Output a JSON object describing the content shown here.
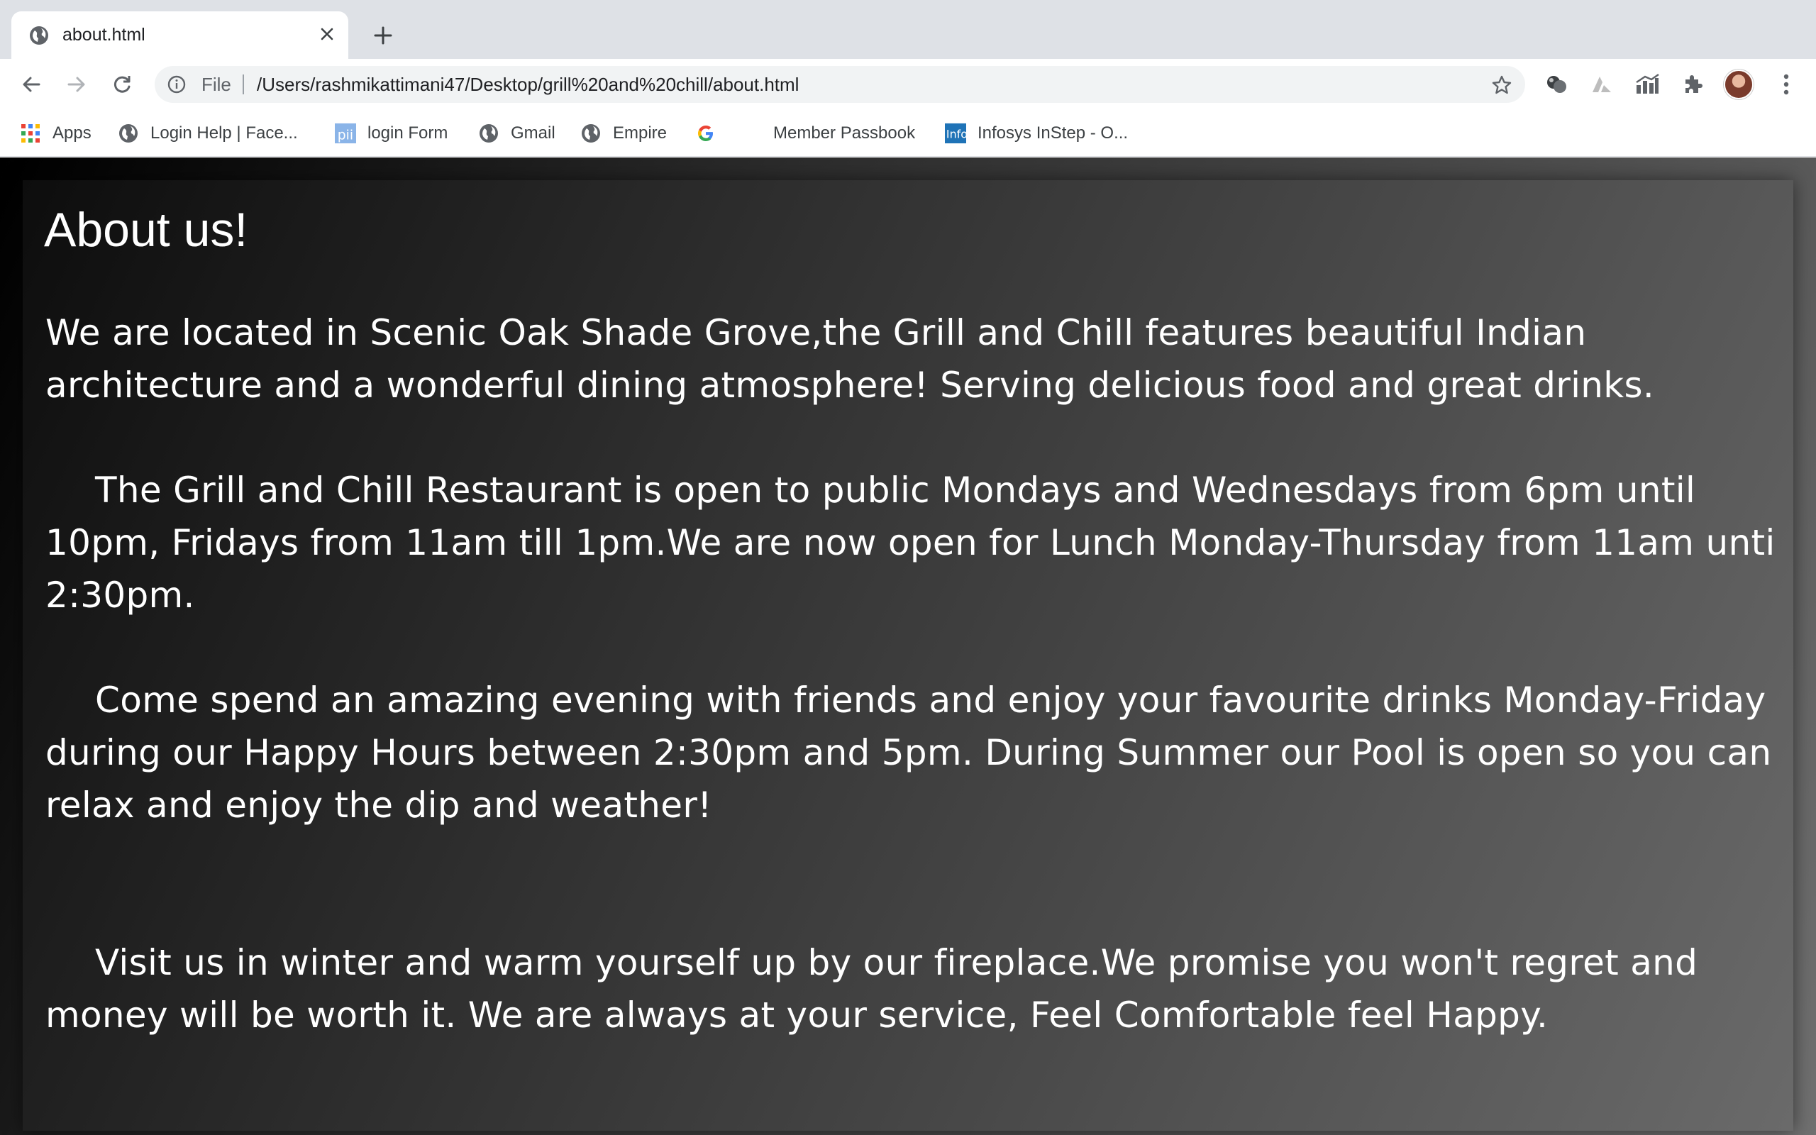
{
  "browser": {
    "tab": {
      "title": "about.html",
      "favicon": "globe-icon",
      "close_icon": "close-icon"
    },
    "new_tab_icon": "plus-icon",
    "toolbar": {
      "back_icon": "back-arrow-icon",
      "forward_icon": "forward-arrow-icon",
      "reload_icon": "reload-icon",
      "address": {
        "info_icon": "info-icon",
        "scheme": "File",
        "url": "/Users/rashmikattimani47/Desktop/grill%20and%20chill/about.html",
        "bookmark_icon": "star-icon"
      },
      "extensions": [
        "extension-balls-icon",
        "extension-triangle-icon",
        "extension-chart-icon",
        "puzzle-icon"
      ],
      "avatar": "profile-avatar",
      "menu_icon": "kebab-menu-icon"
    },
    "bookmarks": [
      {
        "label": "Apps",
        "icon": "apps-grid-icon"
      },
      {
        "label": "Login Help | Face...",
        "icon": "globe-icon"
      },
      {
        "label": "login Form",
        "icon": "pii-icon"
      },
      {
        "label": "Gmail",
        "icon": "globe-icon"
      },
      {
        "label": "Empire",
        "icon": "globe-icon"
      },
      {
        "label": "",
        "icon": "google-g-icon"
      },
      {
        "label": "Member Passbook",
        "icon": ""
      },
      {
        "label": "Infosys InStep - O...",
        "icon": "infosys-icon"
      }
    ]
  },
  "page": {
    "title": "About us!",
    "paragraphs": [
      "We are located in Scenic Oak Shade Grove,the Grill and Chill features beautiful Indian architecture and a wonderful dining atmosphere! Serving delicious food and great drinks.",
      "The Grill and Chill Restaurant is open to public Mondays and Wednesdays from 6pm until 10pm, Fridays from 11am till 1pm.We are now open for Lunch Monday-Thursday from 11am unti 2:30pm.",
      "Come spend an amazing evening with friends and enjoy your favourite drinks Monday-Friday during our Happy Hours between 2:30pm and 5pm. During Summer our Pool is open so you can relax and enjoy the dip and weather!",
      "Visit us in winter and warm yourself up by our fireplace.We promise you won't regret and money will be worth it. We are always at your service, Feel Comfortable feel Happy."
    ]
  },
  "colors": {
    "tabstrip": "#dee1e6",
    "omnibox": "#f1f3f4",
    "page_text": "#ffffff",
    "page_bg_dark": "#000000",
    "page_bg_light": "#707070"
  }
}
